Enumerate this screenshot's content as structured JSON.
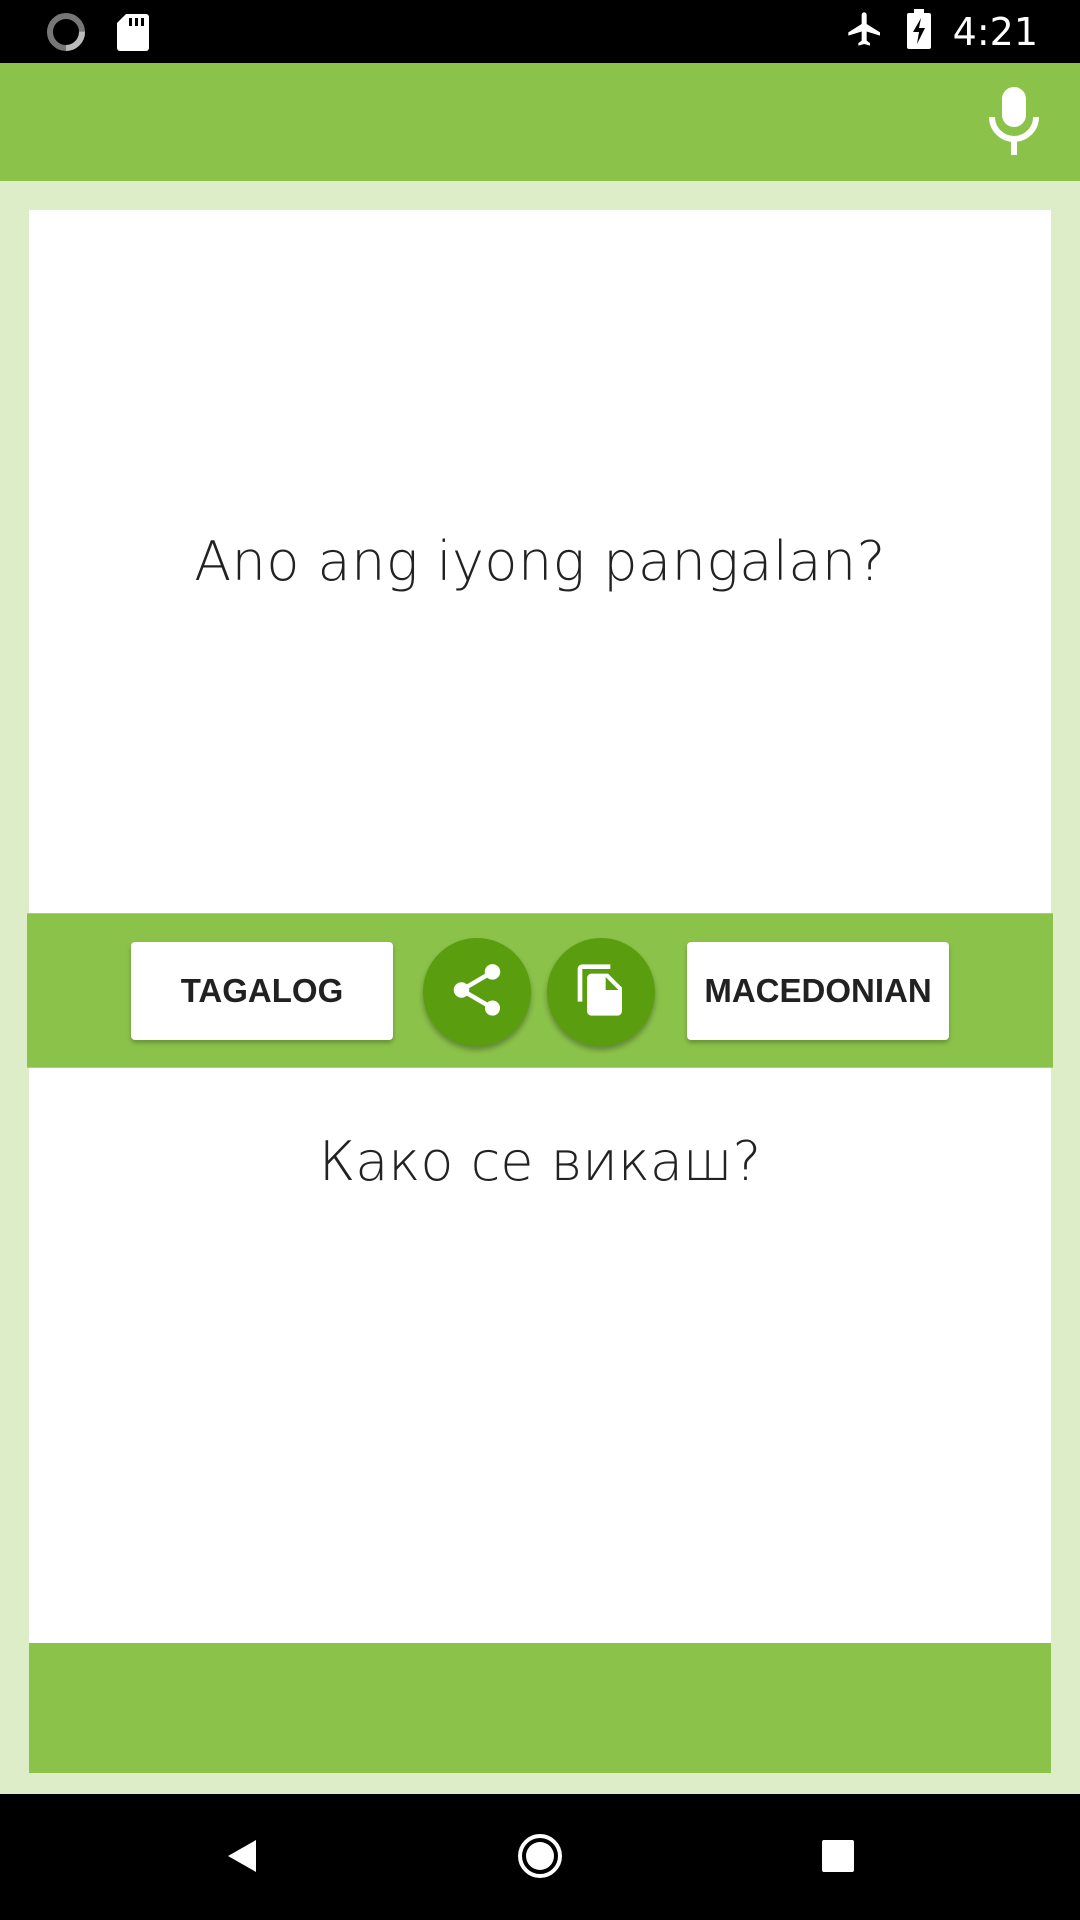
{
  "status_bar": {
    "time": "4:21",
    "left_icons": [
      "loading-spinner-icon",
      "sd-card-icon"
    ],
    "right_icons": [
      "airplane-mode-icon",
      "battery-charging-icon"
    ]
  },
  "toolbar": {
    "mic_icon": "microphone-icon",
    "color": "#8bc34a"
  },
  "source": {
    "text": "Ano ang iyong pangalan?"
  },
  "actions": {
    "source_language": "TAGALOG",
    "target_language": "MACEDONIAN",
    "share_icon": "share-icon",
    "copy_icon": "copy-icon",
    "button_color": "#5a9e0f"
  },
  "target": {
    "text": "Како се викаш?"
  },
  "nav_bar": {
    "icons": [
      "back-icon",
      "home-icon",
      "recents-icon"
    ]
  },
  "colors": {
    "primary": "#8bc34a",
    "background": "#dcedc8",
    "accent": "#5a9e0f"
  }
}
